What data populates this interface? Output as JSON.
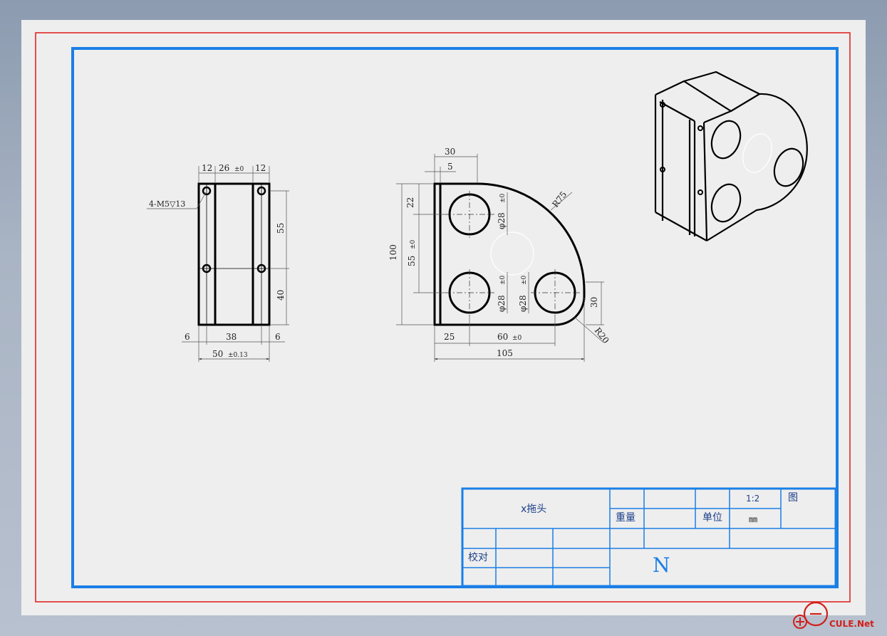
{
  "drawing": {
    "part_name": "x拖头",
    "weight_label": "重量",
    "unit_label": "单位",
    "unit_value": "㎜",
    "scale": "1:2",
    "drawing_label": "图",
    "check_label": "校对",
    "material": "N"
  },
  "front_view": {
    "dims": {
      "top_left": "12",
      "top_mid": "26",
      "top_mid_tol": "±0",
      "top_right": "12",
      "thread": "4-M5▽13",
      "right_upper": "55",
      "right_lower": "40",
      "bottom_left": "6",
      "bottom_mid": "38",
      "bottom_right": "6",
      "overall": "50",
      "overall_tol": "±0.13"
    }
  },
  "side_view": {
    "dims": {
      "top_30": "30",
      "top_5": "5",
      "left_22": "22",
      "left_55": "55",
      "left_55_tol": "±0",
      "left_100": "100",
      "dia_upper": "φ28",
      "dia_upper_tol": "±0",
      "dia_lower_left": "φ28",
      "dia_lower_left_tol": "±0",
      "dia_lower_right": "φ28",
      "dia_lower_right_tol": "±0",
      "r75": "R75",
      "r20": "R20",
      "right_30": "30",
      "bottom_25": "25",
      "bottom_60": "60",
      "bottom_60_tol": "±0",
      "overall_105": "105"
    }
  },
  "watermark": {
    "text": "CULE.Net"
  }
}
